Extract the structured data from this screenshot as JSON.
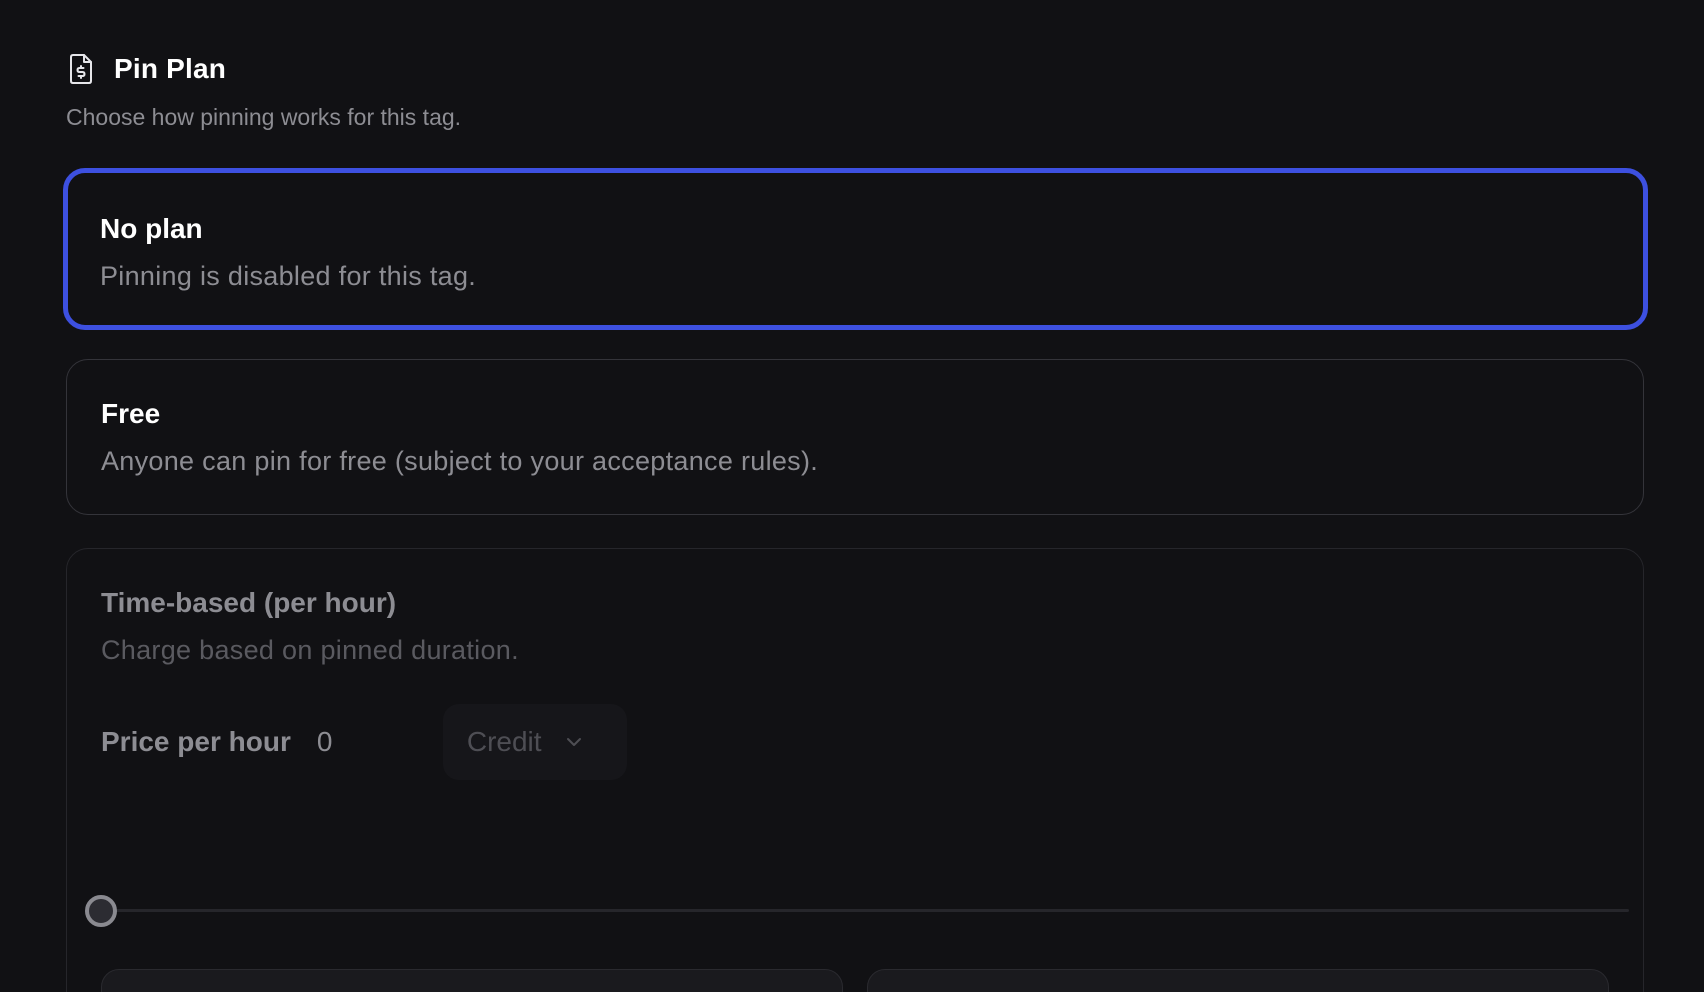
{
  "header": {
    "icon": "file-dollar-icon",
    "title": "Pin Plan",
    "subtitle": "Choose how pinning works for this tag."
  },
  "options": [
    {
      "id": "no_plan",
      "title": "No plan",
      "description": "Pinning is disabled for this tag.",
      "selected": true
    },
    {
      "id": "free",
      "title": "Free",
      "description": "Anyone can pin for free (subject to your acceptance rules).",
      "selected": false
    },
    {
      "id": "time_based",
      "title": "Time-based (per hour)",
      "description": "Charge based on pinned duration.",
      "selected": false,
      "disabled": true,
      "price_label": "Price per hour",
      "price_value": "0",
      "currency": "Credit",
      "slider_value": 0
    }
  ],
  "colors": {
    "background": "#111114",
    "accent": "#3d50e0",
    "muted_text": "#8d8d93",
    "border": "#34343a"
  }
}
